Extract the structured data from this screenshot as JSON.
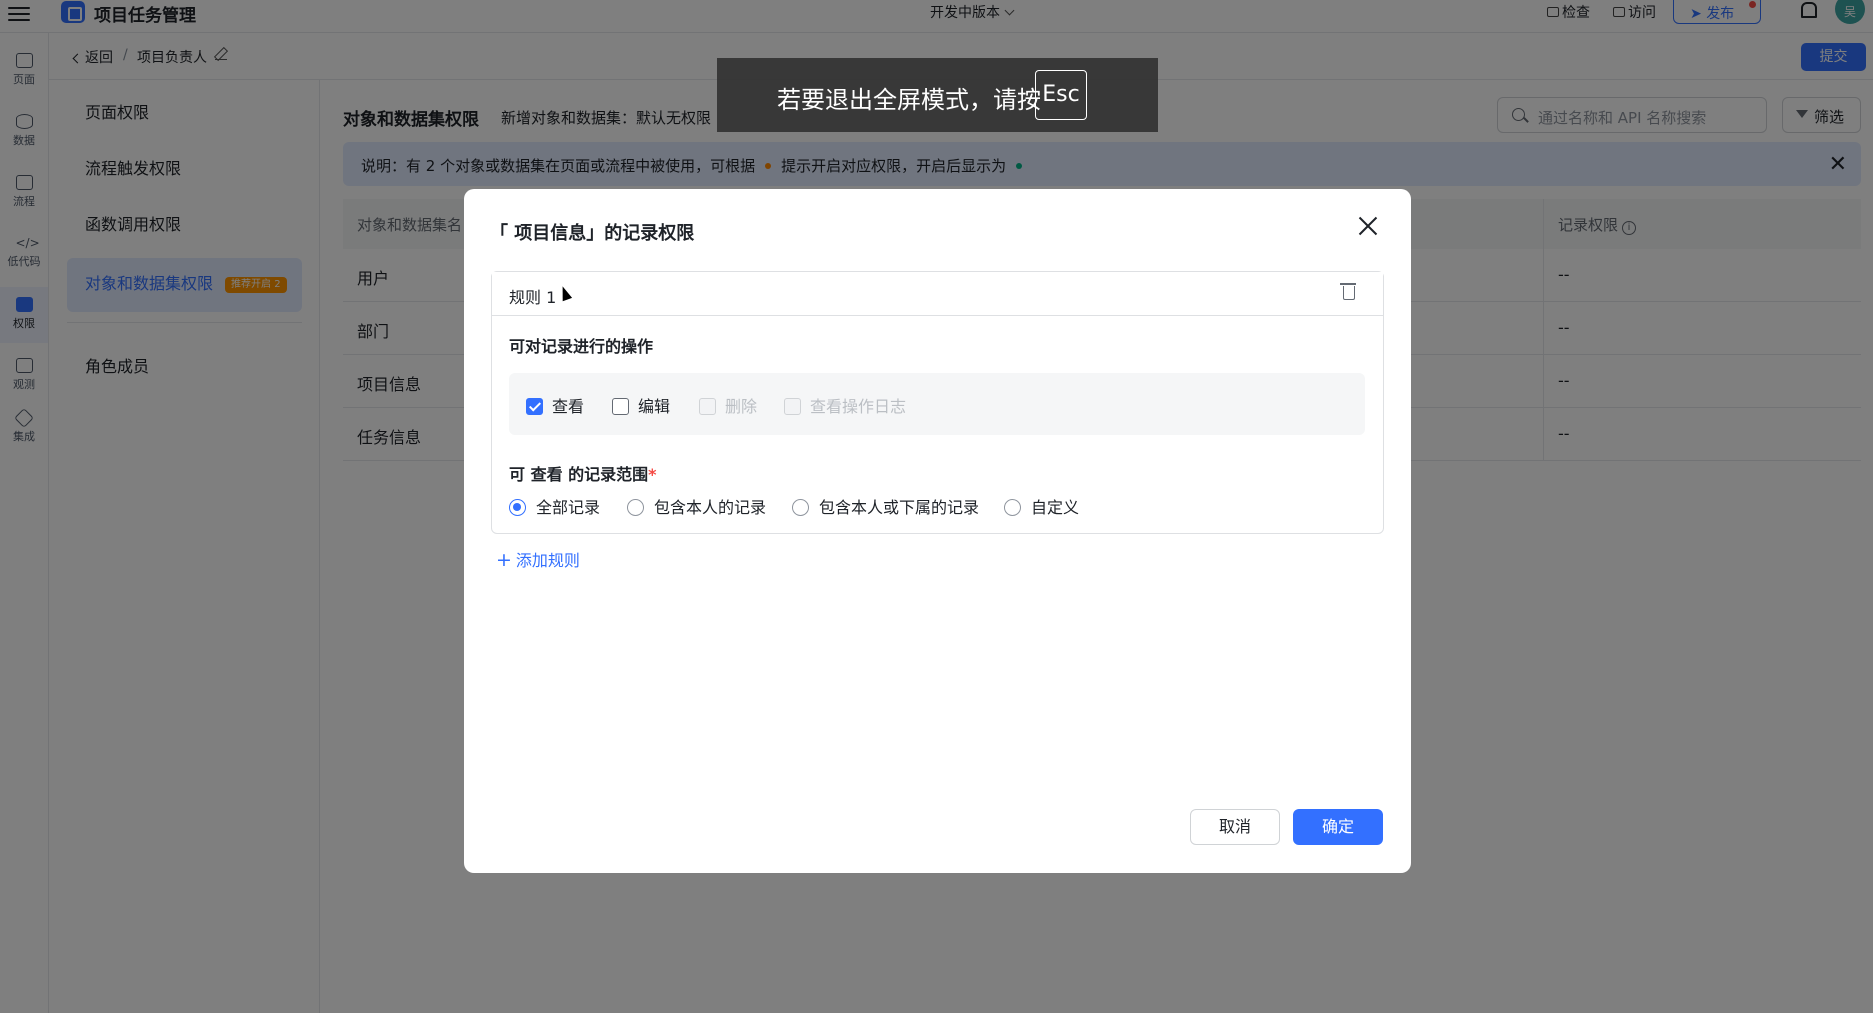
{
  "topbar": {
    "app_title": "项目任务管理",
    "version": "开发中版本",
    "check": "检查",
    "visit": "访问",
    "publish": "发布",
    "avatar": "吴"
  },
  "rail": [
    {
      "label": "页面",
      "icon": "page-icon"
    },
    {
      "label": "数据",
      "icon": "database-icon"
    },
    {
      "label": "流程",
      "icon": "flow-icon"
    },
    {
      "label": "低代码",
      "icon": "code-icon"
    },
    {
      "label": "权限",
      "icon": "lock-icon"
    },
    {
      "label": "观测",
      "icon": "monitor-icon"
    },
    {
      "label": "集成",
      "icon": "integration-icon"
    }
  ],
  "subheader": {
    "back": "返回",
    "separator": "/",
    "current": "项目负责人",
    "submit": "提交"
  },
  "subnav": {
    "items": [
      {
        "label": "页面权限"
      },
      {
        "label": "流程触发权限"
      },
      {
        "label": "函数调用权限"
      },
      {
        "label": "对象和数据集权限",
        "badge": "推荐开启 2"
      },
      {
        "label": "角色成员"
      }
    ]
  },
  "main": {
    "title": "对象和数据集权限",
    "subtitle": "新增对象和数据集：默认无权限",
    "search_placeholder": "通过名称和 API 名称搜索",
    "filter": "筛选",
    "notice_a": "说明：有 2 个对象或数据集在页面或流程中被使用，可根据",
    "notice_b": "提示开启对应权限，开启后显示为",
    "table": {
      "col1": "对象和数据集名",
      "col2": "记录权限",
      "rows": [
        {
          "name": "用户",
          "value": "--"
        },
        {
          "name": "部门",
          "value": "--"
        },
        {
          "name": "项目信息",
          "value": "--"
        },
        {
          "name": "任务信息",
          "value": "--"
        }
      ]
    }
  },
  "modal": {
    "title": "「 项目信息」的记录权限",
    "rule_name": "规则 1",
    "ops_label": "可对记录进行的操作",
    "ops": [
      {
        "label": "查看",
        "checked": true,
        "disabled": false
      },
      {
        "label": "编辑",
        "checked": false,
        "disabled": false
      },
      {
        "label": "删除",
        "checked": false,
        "disabled": true
      },
      {
        "label": "查看操作日志",
        "checked": false,
        "disabled": true
      }
    ],
    "scope_label": "可 查看 的记录范围",
    "scope_required": "*",
    "scopes": [
      {
        "label": "全部记录",
        "selected": true
      },
      {
        "label": "包含本人的记录",
        "selected": false
      },
      {
        "label": "包含本人或下属的记录",
        "selected": false
      },
      {
        "label": "自定义",
        "selected": false
      }
    ],
    "add_rule": "添加规则",
    "cancel": "取消",
    "confirm": "确定"
  },
  "fullscreen_toast": {
    "text": "若要退出全屏模式，请按",
    "key": "Esc"
  },
  "colors": {
    "accent": "#3370ff",
    "overlay": "rgba(0,0,0,0.5)"
  }
}
